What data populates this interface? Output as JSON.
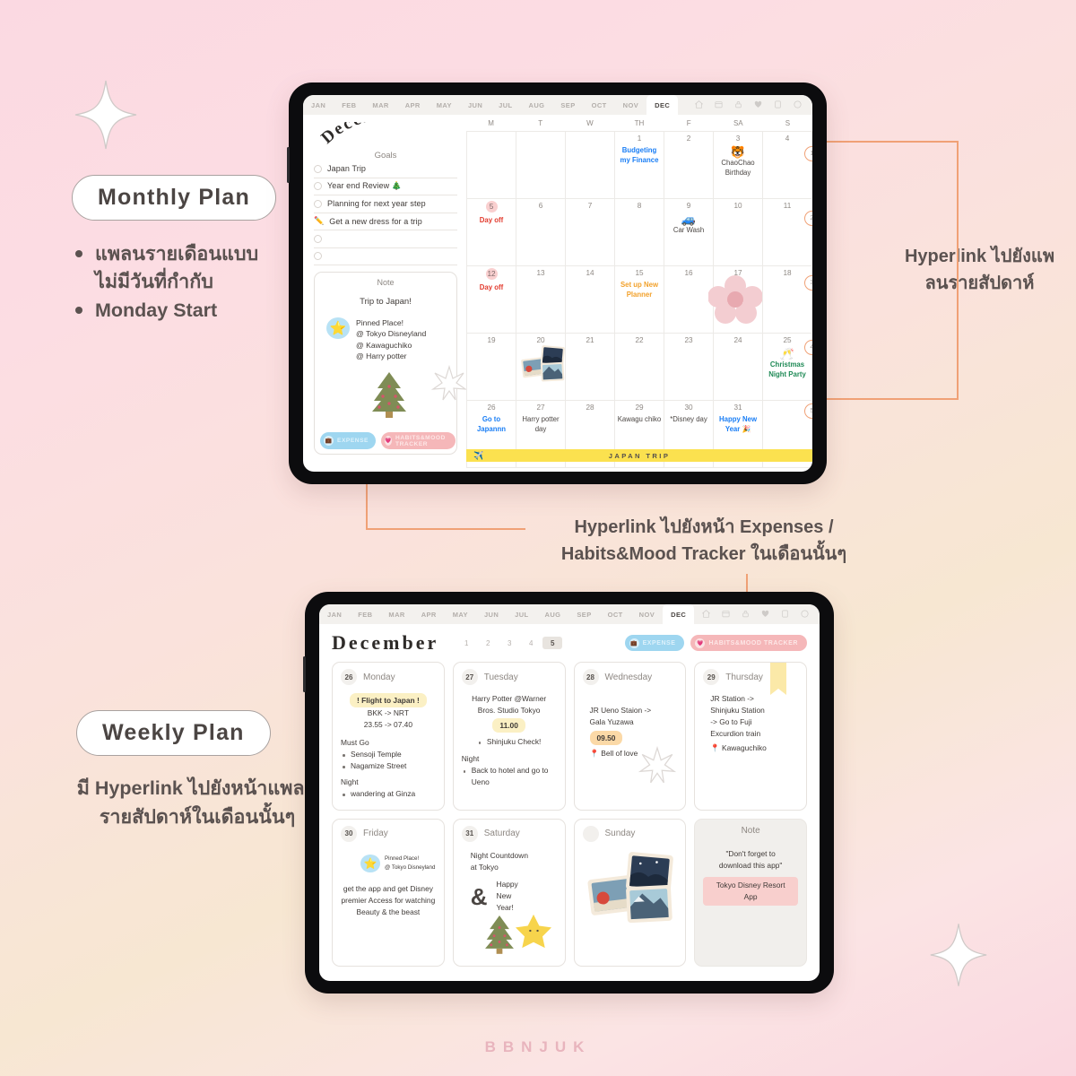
{
  "brand": "BBNJUK",
  "captions": {
    "monthly": {
      "pill": "Monthly Plan",
      "bullets": [
        "แพลนรายเดือนแบบไม่มีวันที่กำกับ",
        "Monday Start"
      ]
    },
    "weekly": {
      "pill": "Weekly Plan",
      "text": "มี Hyperlink ไปยังหน้าแพลนรายสัปดาห์ในเดือนนั้นๆ"
    }
  },
  "annotations": {
    "weekly_link": "Hyperlink ไปยังแพลนรายสัปดาห์",
    "tracker_link": "Hyperlink ไปยังหน้า Expenses / Habits&Mood Tracker ในเดือนนั้นๆ"
  },
  "colors": {
    "accent_orange": "#f0a176",
    "chip_blue": "#9ed6f0",
    "chip_pink": "#f5b7b9",
    "trip_yellow": "#fbe14f",
    "day_marker": "#f9cfcf"
  },
  "monthly": {
    "month_tabs": [
      "JAN",
      "FEB",
      "MAR",
      "APR",
      "MAY",
      "JUN",
      "JUL",
      "AUG",
      "SEP",
      "OCT",
      "NOV",
      "DEC"
    ],
    "active_tab": "DEC",
    "toolbar_icons": [
      "home-icon",
      "calendar-icon",
      "lock-icon",
      "heart-icon",
      "document-icon",
      "sticker-icon"
    ],
    "title": "December",
    "goals_label": "Goals",
    "goals": [
      {
        "text": "Japan Trip",
        "icon": "circle-checkbox"
      },
      {
        "text": "Year end Review 🎄",
        "icon": "circle-checkbox"
      },
      {
        "text": "Planning for next year step",
        "icon": "circle-checkbox"
      },
      {
        "text": "Get a new dress for a trip",
        "icon": "pen-icon"
      },
      {
        "text": "",
        "icon": "circle-checkbox"
      },
      {
        "text": "",
        "icon": "circle-checkbox"
      },
      {
        "text": "",
        "icon": "circle-checkbox"
      }
    ],
    "note": {
      "title": "Note",
      "heading": "Trip to Japan!",
      "pinned_title": "Pinned Place!",
      "pinned_places": [
        "@ Tokyo Disneyland",
        "@ Kawaguchiko",
        "@ Harry potter"
      ]
    },
    "link_chips": [
      {
        "label": "EXPENSE",
        "icon": "wallet-icon",
        "style": "expense"
      },
      {
        "label": "HABITS&MOOD TRACKER",
        "icon": "heart-icon",
        "style": "habits"
      }
    ],
    "weekday_headers": [
      "M",
      "T",
      "W",
      "TH",
      "F",
      "SA",
      "S"
    ],
    "week_numbers": [
      "1",
      "2",
      "3",
      "4",
      "5"
    ],
    "trip_bar_label": "JAPAN TRIP",
    "trip_bar_icon": "✈️",
    "days": [
      {
        "n": "",
        "events": []
      },
      {
        "n": "",
        "events": []
      },
      {
        "n": "",
        "events": []
      },
      {
        "n": "1",
        "events": [
          {
            "text": "Budgeting my Finance",
            "color": "blue"
          }
        ]
      },
      {
        "n": "2",
        "events": []
      },
      {
        "n": "3",
        "events": [
          {
            "emoji": "🐯",
            "text": "ChaoChao Birthday",
            "color": "plain"
          }
        ]
      },
      {
        "n": "4",
        "events": []
      },
      {
        "n": "5",
        "marked": true,
        "events": [
          {
            "text": "Day off",
            "color": "red"
          }
        ]
      },
      {
        "n": "6",
        "events": []
      },
      {
        "n": "7",
        "events": []
      },
      {
        "n": "8",
        "events": []
      },
      {
        "n": "9",
        "events": [
          {
            "emoji": "🚙",
            "text": "Car Wash",
            "color": "plain"
          }
        ]
      },
      {
        "n": "10",
        "events": []
      },
      {
        "n": "11",
        "events": []
      },
      {
        "n": "12",
        "marked": true,
        "events": [
          {
            "text": "Day off",
            "color": "red"
          }
        ]
      },
      {
        "n": "13",
        "events": []
      },
      {
        "n": "14",
        "events": []
      },
      {
        "n": "15",
        "events": [
          {
            "text": "Set up New Planner",
            "color": "orange"
          }
        ]
      },
      {
        "n": "16",
        "events": []
      },
      {
        "n": "17",
        "events": [
          {
            "sticker": "flower"
          }
        ]
      },
      {
        "n": "18",
        "events": []
      },
      {
        "n": "19",
        "events": []
      },
      {
        "n": "20",
        "events": [
          {
            "sticker": "photos"
          }
        ]
      },
      {
        "n": "21",
        "events": []
      },
      {
        "n": "22",
        "events": []
      },
      {
        "n": "23",
        "events": []
      },
      {
        "n": "24",
        "events": []
      },
      {
        "n": "25",
        "events": [
          {
            "emoji": "🥂",
            "text": "Christmas Night Party",
            "color": "green"
          }
        ]
      },
      {
        "n": "26",
        "events": [
          {
            "text": "Go to Japannn",
            "color": "blue"
          }
        ]
      },
      {
        "n": "27",
        "events": [
          {
            "text": "Harry potter day",
            "color": "plain"
          }
        ]
      },
      {
        "n": "28",
        "events": []
      },
      {
        "n": "29",
        "events": [
          {
            "text": "Kawagu chiko",
            "color": "plain"
          }
        ]
      },
      {
        "n": "30",
        "events": [
          {
            "text": "*Disney day",
            "color": "plain"
          }
        ]
      },
      {
        "n": "31",
        "events": [
          {
            "text": "Happy New Year",
            "color": "blue",
            "emoji_after": "🎉"
          }
        ]
      },
      {
        "n": "",
        "events": []
      }
    ]
  },
  "weekly": {
    "month_tabs": [
      "JAN",
      "FEB",
      "MAR",
      "APR",
      "MAY",
      "JUN",
      "JUL",
      "AUG",
      "SEP",
      "OCT",
      "NOV",
      "DEC"
    ],
    "active_tab": "DEC",
    "title": "December",
    "week_numbers": [
      "1",
      "2",
      "3",
      "4",
      "5"
    ],
    "active_week": "5",
    "link_chips": [
      {
        "label": "EXPENSE",
        "icon": "wallet-icon",
        "style": "expense"
      },
      {
        "label": "HABITS&MOOD TRACKER",
        "icon": "heart-icon",
        "style": "habits"
      }
    ],
    "cards": [
      {
        "num": "26",
        "day": "Monday",
        "highlight": "! Flight to Japan !",
        "center_lines": [
          "BKK -> NRT",
          "23.55 -> 07.40"
        ],
        "sections": [
          {
            "label": "Must Go",
            "items": [
              "Sensoji Temple",
              "Nagamize Street"
            ]
          },
          {
            "label": "Night",
            "items": [
              "wandering at Ginza"
            ]
          }
        ]
      },
      {
        "num": "27",
        "day": "Tuesday",
        "center_lines": [
          "Harry Potter @Warner",
          "Bros. Studio Tokyo"
        ],
        "highlight_center": "11.00",
        "bullet_center": "Shinjuku Check!",
        "sections": [
          {
            "label": "Night",
            "items": [
              "Back to hotel and go to Ueno"
            ]
          }
        ]
      },
      {
        "num": "28",
        "day": "Wednesday",
        "lines": [
          "JR Ueno Staion ->",
          "Gala Yuzawa"
        ],
        "highlight_orange": "09.50",
        "pin_line": "📍 Bell of love",
        "sticker": "asterisk"
      },
      {
        "num": "29",
        "day": "Thursday",
        "lines": [
          "JR Station ->",
          "Shinjuku Station",
          "-> Go to Fuji",
          "Excurdion train"
        ],
        "pin_line": "📍 Kawaguchiko",
        "sticker": "bookmark"
      },
      {
        "num": "30",
        "day": "Friday",
        "pinned_title": "Pinned Place!",
        "pinned_sub": "@ Tokyo Disneyland",
        "center_block": "get the app and get Disney premier Access for watching Beauty & the beast"
      },
      {
        "num": "31",
        "day": "Saturday",
        "lines": [
          "Night Countdown",
          "at Tokyo"
        ],
        "amp": "&",
        "amp_text": [
          "Happy",
          "New",
          "Year!"
        ],
        "sticker": "tree-star"
      },
      {
        "num": "",
        "day": "Sunday",
        "sticker": "photos"
      },
      {
        "note_title": "Note",
        "quote_lines": [
          "\"Don't forget to",
          "download this app\""
        ],
        "pill": "Tokyo Disney Resort App"
      }
    ]
  }
}
